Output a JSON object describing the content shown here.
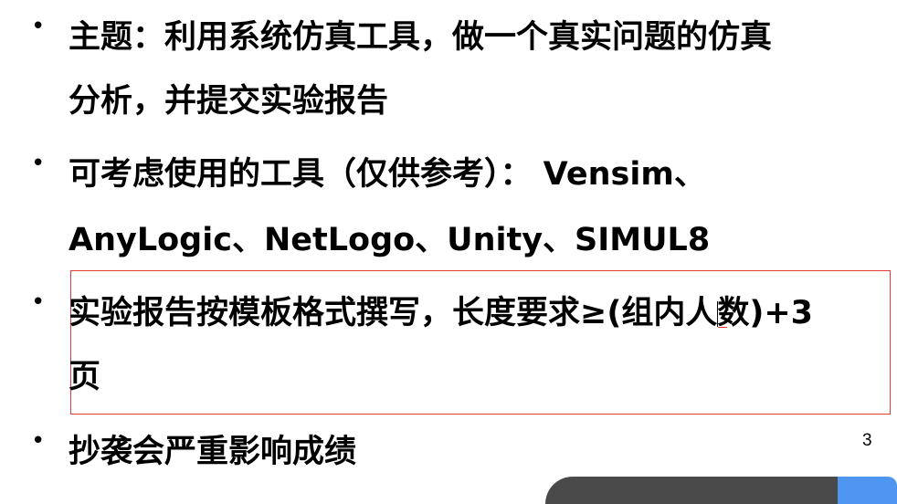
{
  "slide": {
    "bullets": [
      {
        "lines": [
          "主题：利用系统仿真工具，做一个真实问题的仿真",
          "分析，并提交实验报告"
        ]
      },
      {
        "lines": [
          "可考虑使用的工具（仅供参考）： Vensim、",
          "AnyLogic、NetLogo、Unity、SIMUL8"
        ]
      },
      {
        "lines": [
          "实验报告按模板格式撰写，长度要求≥(组内人数)+3",
          "页"
        ]
      },
      {
        "lines": [
          "抄袭会严重影响成绩"
        ]
      }
    ],
    "bullet_glyph": "•",
    "page_number": "3"
  },
  "colors": {
    "selection_border": "#e53935",
    "toolbar_dark": "#4a4a4a",
    "toolbar_blue": "#4f96f0"
  }
}
